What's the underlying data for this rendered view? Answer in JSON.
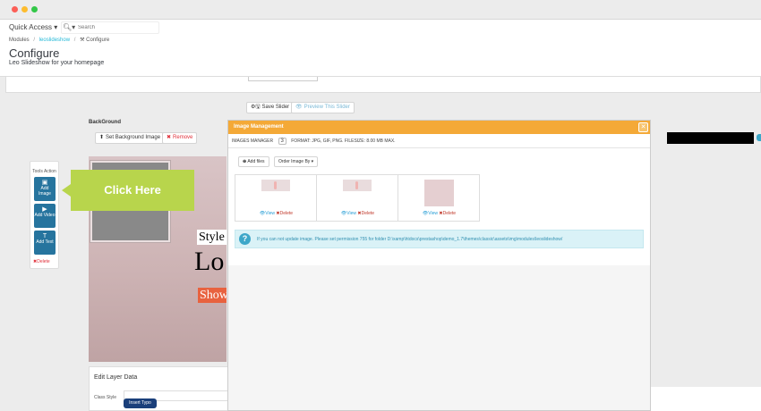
{
  "window": {
    "dots": [
      "#fc5f57",
      "#fdbc2e",
      "#33c748"
    ]
  },
  "adminbar": {
    "quick_access": "Quick Access ▾",
    "search_placeholder": "Search"
  },
  "breadcrumb": [
    "Modules",
    "leoslideshow",
    "Configure"
  ],
  "page": {
    "title": "Configure",
    "subtitle": "Leo Slideshow for your homepage"
  },
  "toolbar": {
    "save_slider": "Save Slider",
    "preview_slider": "Preview This Slider"
  },
  "background": {
    "label": "BackGround",
    "set_bg": "Set Background Image",
    "remove": "Remove"
  },
  "tools": {
    "title": "Tools Action",
    "items": [
      {
        "label": "Add Image",
        "icon": "image-icon"
      },
      {
        "label": "Add Video",
        "icon": "video-icon"
      },
      {
        "label": "Add Text",
        "icon": "text-icon"
      }
    ],
    "delete": "Delete"
  },
  "callout": {
    "label": "Click Here"
  },
  "slide": {
    "text_style": "Style",
    "text_lo": "Lo",
    "text_show": "Show"
  },
  "layer": {
    "heading": "Edit Layer Data",
    "class_style": "Class Style",
    "insert_typo": "Insert Typo"
  },
  "modal": {
    "title": "Image Management",
    "manager_label": "IMAGES MANAGER",
    "count": "3",
    "format": "FORMAT: JPG, GIF, PNG. FILESIZE: 8.00 MB MAX.",
    "add_files": "Add files",
    "order_by": "Order Image By ▾",
    "thumbs": [
      {
        "view": "View",
        "delete": "Delete"
      },
      {
        "view": "View",
        "delete": "Delete"
      },
      {
        "view": "View",
        "delete": "Delete"
      }
    ],
    "info": "If you can not update image. Please set permission 755 for folder D:\\xamp\\htdocs\\prestashop\\demo_1.7\\themes\\classic\\assets\\img\\modules\\leoslideshow/"
  },
  "colors": {
    "accent": "#25b9d7",
    "modal_header": "#f4a937",
    "tool_button": "#26749e",
    "callout": "#b8d54c",
    "info_bg": "#daf2f7"
  }
}
